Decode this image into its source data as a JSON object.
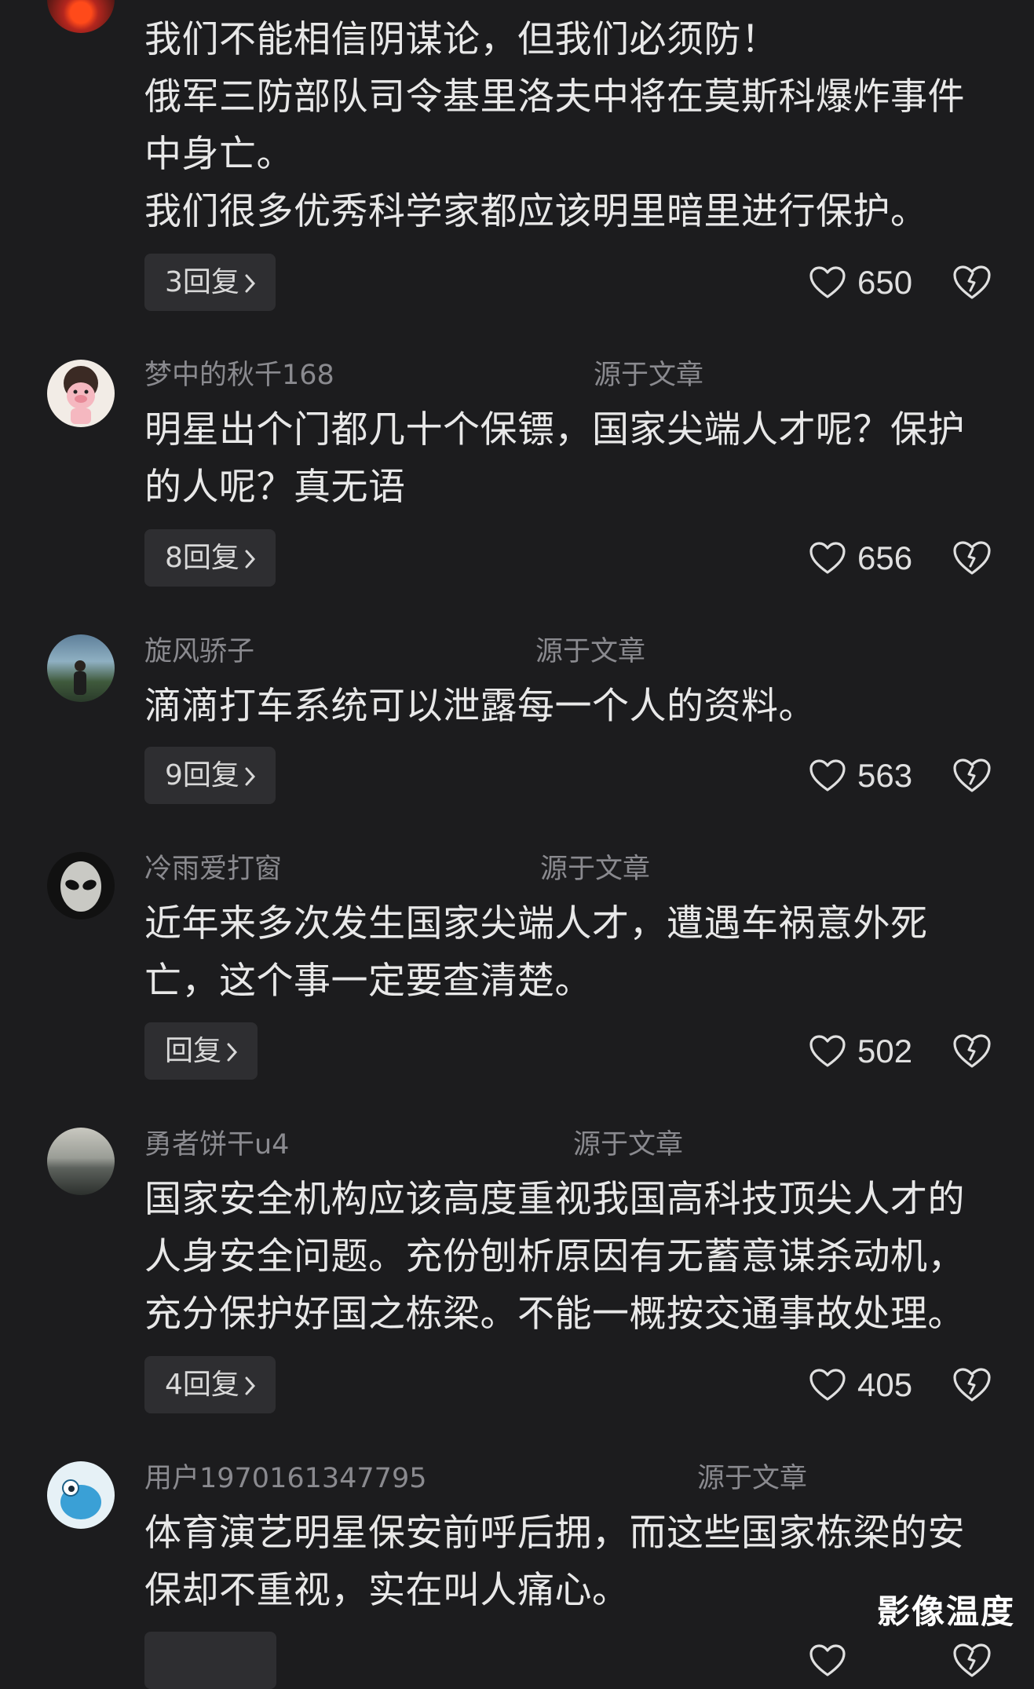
{
  "comments": [
    {
      "username": "",
      "source": "",
      "lines": [
        "我们不能相信阴谋论，但我们必须防！",
        "俄军三防部队司令基里洛夫中将在莫斯科爆炸事件",
        "中身亡。",
        "我们很多优秀科学家都应该明里暗里进行保护。"
      ],
      "reply_label": "3回复",
      "likes": "650"
    },
    {
      "username": "梦中的秋千168",
      "source": "源于文章",
      "lines": [
        "明星出个门都几十个保镖，国家尖端人才呢？保护",
        "的人呢？真无语"
      ],
      "reply_label": "8回复",
      "likes": "656"
    },
    {
      "username": "旋风骄子",
      "source": "源于文章",
      "lines": [
        "滴滴打车系统可以泄露每一个人的资料。"
      ],
      "reply_label": "9回复",
      "likes": "563"
    },
    {
      "username": "冷雨爱打窗",
      "source": "源于文章",
      "lines": [
        "近年来多次发生国家尖端人才，遭遇车祸意外死",
        "亡，这个事一定要查清楚。"
      ],
      "reply_label": "回复",
      "likes": "502"
    },
    {
      "username": "勇者饼干u4",
      "source": "源于文章",
      "lines": [
        "国家安全机构应该高度重视我国高科技顶尖人才的",
        "人身安全问题。充份刨析原因有无蓄意谋杀动机，",
        "充分保护好国之栋梁。不能一概按交通事故处理。"
      ],
      "reply_label": "4回复",
      "likes": "405"
    },
    {
      "username": "用户1970161347795",
      "source": "源于文章",
      "lines": [
        "体育演艺明星保安前呼后拥，而这些国家栋梁的安",
        "保却不重视，实在叫人痛心。"
      ],
      "reply_label": "",
      "likes": ""
    }
  ],
  "icons": {
    "like": "heart-outline-icon",
    "dislike": "broken-heart-icon",
    "reply_chevron": "chevron-right-icon"
  },
  "watermark": "影像温度"
}
